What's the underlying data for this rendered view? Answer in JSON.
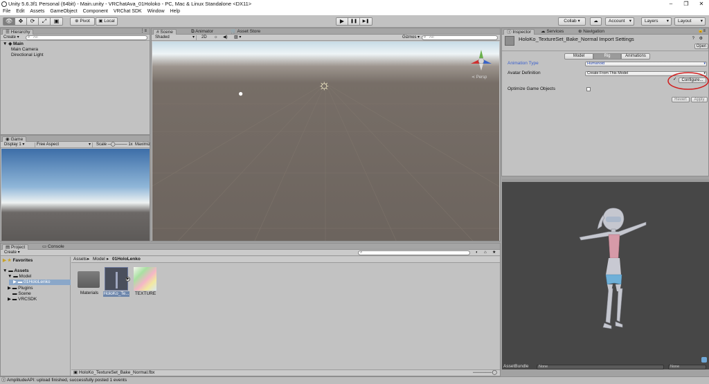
{
  "window": {
    "title": "Unity 5.6.3f1 Personal (64bit) - Main.unity - VRChatAva_01Holoko - PC, Mac & Linux Standalone <DX11>",
    "controls": [
      "–",
      "❐",
      "✕"
    ]
  },
  "menu": [
    "File",
    "Edit",
    "Assets",
    "GameObject",
    "Component",
    "VRChat SDK",
    "Window",
    "Help"
  ],
  "toolbar": {
    "pivot": "Pivot",
    "local": "Local",
    "collab": "Collab ▾",
    "cloud": "☁",
    "account": "Account",
    "layers": "Layers",
    "layout": "Layout",
    "play": "▶",
    "pause": "❚❚",
    "step": "▶❚",
    "tools": [
      "👁",
      "✥",
      "⟳",
      "⤢",
      "▣"
    ]
  },
  "hierarchy": {
    "tab": "Hierarchy",
    "create": "Create",
    "search_placeholder": "All",
    "scene": "Main",
    "items": [
      "Main Camera",
      "Directional Light"
    ]
  },
  "scene": {
    "tabs": [
      "Scene",
      "Animator",
      "Asset Store"
    ],
    "shading": "Shaded",
    "mode2d": "2D",
    "gizmos": "Gizmos",
    "search_placeholder": "All",
    "persp": "Persp"
  },
  "game": {
    "tab": "Game",
    "display": "Display 1",
    "aspect": "Free Aspect",
    "scale_label": "Scale",
    "scale_value": "1x",
    "maximize": "Maximiz"
  },
  "project": {
    "tabs": [
      "Project",
      "Console"
    ],
    "create": "Create",
    "favorites": "Favorites",
    "tree": [
      {
        "label": "Assets",
        "level": 0
      },
      {
        "label": "Model",
        "level": 1
      },
      {
        "label": "01HoloLenko",
        "level": 2
      },
      {
        "label": "Plugins",
        "level": 1
      },
      {
        "label": "Scene",
        "level": 1
      },
      {
        "label": "VRCSDK",
        "level": 1
      }
    ],
    "breadcrumb": [
      "Assets",
      "Model",
      "01HoloLenko"
    ],
    "assets": [
      "Materials",
      "HoloKo_Te...",
      "TEXTURE"
    ],
    "selected_file": "HoloKo_TextureSet_Bake_Normal.fbx"
  },
  "inspector": {
    "tabs": [
      "Inspector",
      "Services",
      "Navigation"
    ],
    "title": "HoloKo_TextureSet_Bake_Normal Import Settings",
    "open": "Open",
    "subtabs": [
      "Model",
      "Rig",
      "Animations"
    ],
    "animation_type_label": "Animation Type",
    "animation_type": "Humanoid",
    "avatar_def_label": "Avatar Definition",
    "avatar_def": "Create From This Model",
    "check": "✓",
    "configure": "Configure...",
    "optimize_label": "Optimize Game Objects",
    "revert": "Revert",
    "apply": "Apply"
  },
  "preview": {
    "assetbundle_label": "AssetBundle",
    "bundle1": "None",
    "bundle2": "None"
  },
  "status": {
    "text": "AmplitudeAPI: upload finished, successfully posted 1 events"
  },
  "colors": {
    "panel": "#c2c2c2",
    "accent_blue": "#3a5fcd",
    "highlight_red": "#d11d1d",
    "preview_bg": "#474747"
  }
}
